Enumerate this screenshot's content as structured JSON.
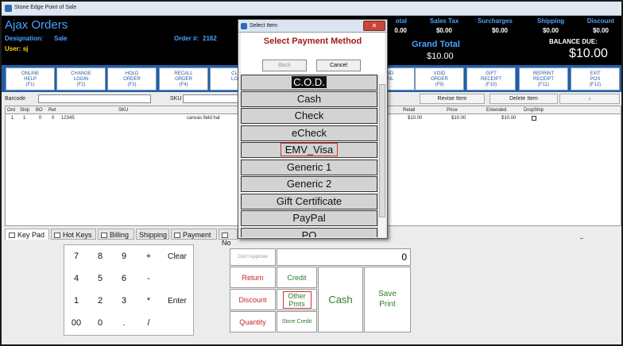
{
  "window": {
    "title": "Stone Edge Point of Sale"
  },
  "header": {
    "app_name": "Ajax Orders",
    "designation_label": "Designation:",
    "designation_value": "Sale",
    "order_label": "Order #:",
    "order_value": "2162",
    "user_label": "User:",
    "user_value": "sj",
    "totals": [
      {
        "label": "otal",
        "value": "0.00"
      },
      {
        "label": "Sales Tax",
        "value": "$0.00"
      },
      {
        "label": "Surcharges",
        "value": "$0.00"
      },
      {
        "label": "Shipping",
        "value": "$0.00"
      },
      {
        "label": "Discount",
        "value": "$0.00"
      }
    ],
    "grand_total_label": "Grand Total",
    "grand_total_value": "$10.00",
    "balance_label": "BALANCE DUE:",
    "balance_value": "$10.00"
  },
  "fkeys": [
    {
      "line1": "ONLINE",
      "line2": "HELP",
      "key": "(F1)"
    },
    {
      "line1": "CHANGE",
      "line2": "LOGIN",
      "key": "(F2)"
    },
    {
      "line1": "HOLD",
      "line2": "ORDER",
      "key": "(F3)"
    },
    {
      "line1": "RECALL",
      "line2": "ORDER",
      "key": "(F4)"
    },
    {
      "line1": "CL",
      "line2": "LO",
      "key": ""
    },
    {
      "line1": "ND",
      "line2": "AIL",
      "key": ""
    },
    {
      "line1": "VOID",
      "line2": "ORDER",
      "key": "(F9)"
    },
    {
      "line1": "GIFT",
      "line2": "RECEIPT",
      "key": "(F10)"
    },
    {
      "line1": "REPRINT",
      "line2": "RECEIPT",
      "key": "(F11)"
    },
    {
      "line1": "EXIT",
      "line2": "POS",
      "key": "(F12)"
    }
  ],
  "entry": {
    "barcode_label": "Barcode",
    "sku_label": "SKU",
    "revise_item": "Revise Item",
    "delete_item": "Delete Item",
    "down_arrow": "↓"
  },
  "grid": {
    "headers": {
      "ord": "Ord",
      "ship": "Ship",
      "bo": "BO",
      "ret": "Ret",
      "sku": "SKU",
      "retail": "Retail",
      "price": "Price",
      "extended": "Extended",
      "dropship": "DropShip"
    },
    "rows": [
      {
        "ord": "1",
        "ship": "1",
        "bo": "0",
        "ret": "0",
        "sku": "12345",
        "desc": "canvas field hat",
        "retail": "$10.00",
        "price": "$10.00",
        "extended": "$10.00"
      }
    ]
  },
  "tabs": [
    {
      "label": "Key Pad"
    },
    {
      "label": "Hot Keys"
    },
    {
      "label": "Billing"
    },
    {
      "label": "Shipping"
    },
    {
      "label": "Payment"
    },
    {
      "label": "No"
    }
  ],
  "keypad": {
    "row1": [
      "7",
      "8",
      "9",
      "+",
      "Clear"
    ],
    "row2": [
      "4",
      "5",
      "6",
      "-"
    ],
    "row3": [
      "1",
      "2",
      "3",
      "*"
    ],
    "row4": [
      "00",
      "0",
      ".",
      "/"
    ],
    "enter": "Enter"
  },
  "payment": {
    "dont_approve": "Don't Approve",
    "amount": "0",
    "return": "Return",
    "discount": "Discount",
    "quantity": "Quantity",
    "credit": "Credit",
    "other_pmts_line1": "Other",
    "other_pmts_line2": "Pmts",
    "store_credit": "Store Credit",
    "cash": "Cash",
    "save_line1": "Save",
    "save_line2": "Print"
  },
  "modal": {
    "title": "Select Item",
    "close": "✕",
    "heading": "Select Payment Method",
    "back": "Back",
    "cancel": "Cancel",
    "options": [
      "C.O.D.",
      "Cash",
      "Check",
      "eCheck",
      "EMV_Visa",
      "Generic 1",
      "Generic 2",
      "Gift Certificate",
      "PayPal",
      "PO"
    ]
  }
}
